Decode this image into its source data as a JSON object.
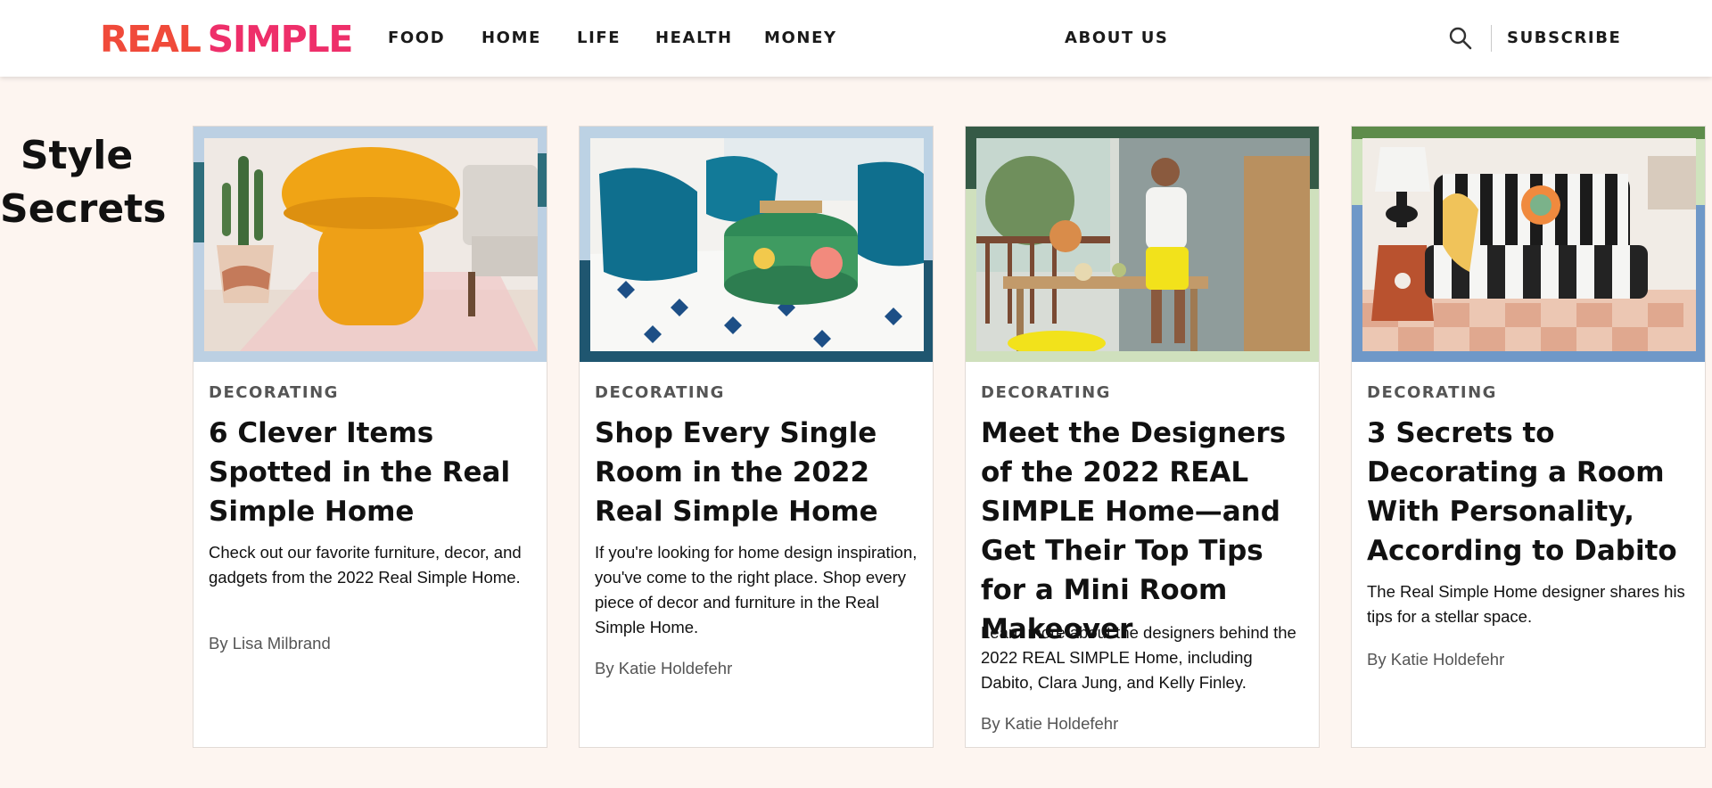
{
  "header": {
    "logo_word1": "REAL",
    "logo_word2": "SIMPLE",
    "nav": [
      "FOOD",
      "HOME",
      "LIFE",
      "HEALTH",
      "MONEY"
    ],
    "about": "ABOUT US",
    "subscribe": "SUBSCRIBE",
    "search_icon": "search-icon"
  },
  "section": {
    "title_line1": "Style",
    "title_line2": "Secrets"
  },
  "cards": [
    {
      "tag": "DECORATING",
      "title": "6 Clever Items Spotted in the Real Simple Home",
      "desc": "Check out our favorite furniture, decor, and gadgets from the 2022 Real Simple Home.",
      "byline": "By Lisa Milbrand",
      "frame_color": "#bcd0e3",
      "frame_accent": "#2e6e7c"
    },
    {
      "tag": "DECORATING",
      "title": "Shop Every Single Room in the 2022 Real Simple Home",
      "desc": "If you're looking for home design inspiration, you've come to the right place. Shop every piece of decor and furniture in the Real Simple Home.",
      "byline": "By Katie Holdefehr",
      "frame_color": "#bcd2e4",
      "frame_accent": "#1f5670"
    },
    {
      "tag": "DECORATING",
      "title": "Meet the Designers of the 2022 REAL SIMPLE Home—and Get Their Top Tips for a Mini Room Makeover",
      "desc": "Learn more about the designers behind the 2022 REAL SIMPLE Home, including Dabito, Clara Jung, and Kelly Finley.",
      "byline": "By Katie Holdefehr",
      "frame_color": "#cfe0bd",
      "frame_accent": "#355a46"
    },
    {
      "tag": "DECORATING",
      "title": "3 Secrets to Decorating a Room With Personality, According to Dabito",
      "desc": "The Real Simple Home designer shares his tips for a stellar space.",
      "byline": "By Katie Holdefehr",
      "frame_color": "#cfe3bd",
      "frame_accent": "#6f98c8"
    }
  ]
}
